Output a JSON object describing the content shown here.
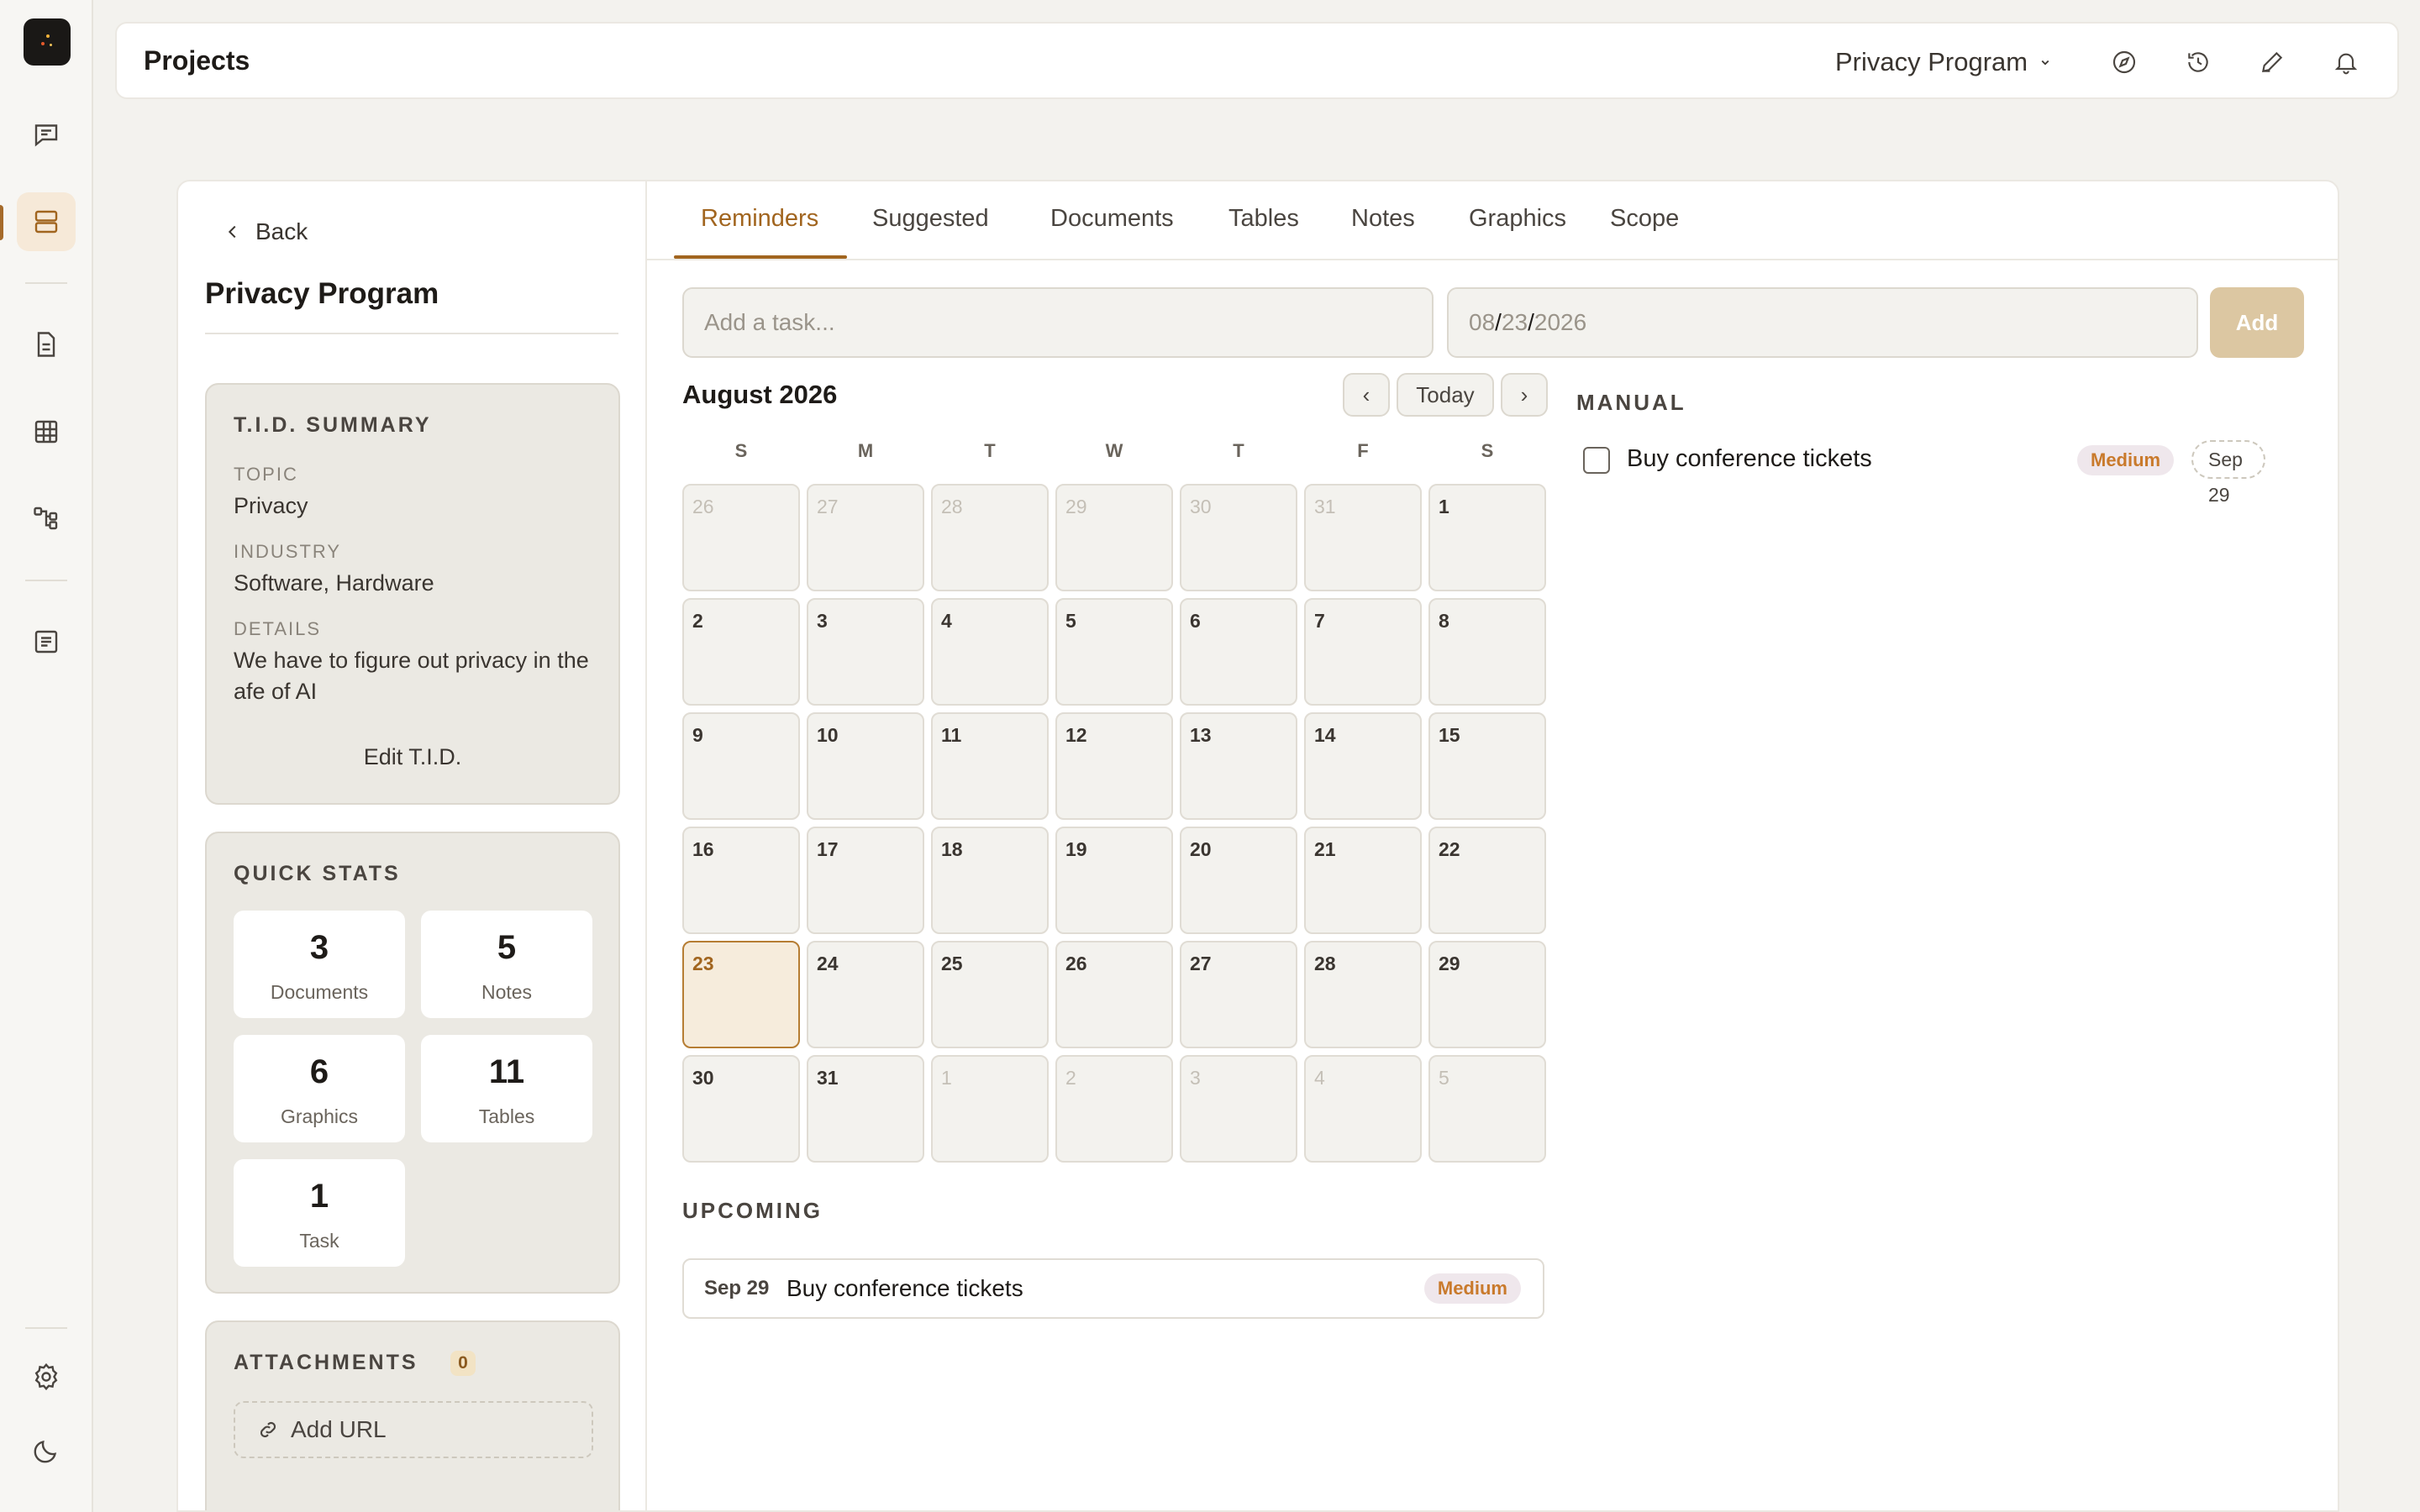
{
  "header": {
    "title": "Projects",
    "project_selector": "Privacy Program"
  },
  "left": {
    "back_label": "Back",
    "project_title": "Privacy Program",
    "tid": {
      "heading": "T.I.D. SUMMARY",
      "topic_label": "TOPIC",
      "topic_value": "Privacy",
      "industry_label": "INDUSTRY",
      "industry_value": "Software, Hardware",
      "details_label": "DETAILS",
      "details_value": "We have to figure out privacy in the afe of AI",
      "edit_label": "Edit T.I.D."
    },
    "stats": {
      "heading": "QUICK STATS",
      "items": [
        {
          "value": "3",
          "label": "Documents"
        },
        {
          "value": "5",
          "label": "Notes"
        },
        {
          "value": "6",
          "label": "Graphics"
        },
        {
          "value": "11",
          "label": "Tables"
        },
        {
          "value": "1",
          "label": "Task"
        }
      ]
    },
    "attachments": {
      "heading": "ATTACHMENTS",
      "count": "0",
      "add_url_label": "Add URL"
    }
  },
  "tabs": [
    "Reminders",
    "Suggested",
    "Documents",
    "Tables",
    "Notes",
    "Graphics",
    "Scope"
  ],
  "task_form": {
    "task_placeholder": "Add a task...",
    "date_month": "08",
    "date_day": "23",
    "date_year": "2026",
    "add_label": "Add"
  },
  "calendar": {
    "month_label": "August 2026",
    "prev_label": "‹",
    "today_label": "Today",
    "next_label": "›",
    "weekdays": [
      "S",
      "M",
      "T",
      "W",
      "T",
      "F",
      "S"
    ],
    "weeks": [
      [
        "26",
        "27",
        "28",
        "29",
        "30",
        "31",
        "1"
      ],
      [
        "2",
        "3",
        "4",
        "5",
        "6",
        "7",
        "8"
      ],
      [
        "9",
        "10",
        "11",
        "12",
        "13",
        "14",
        "15"
      ],
      [
        "16",
        "17",
        "18",
        "19",
        "20",
        "21",
        "22"
      ],
      [
        "23",
        "24",
        "25",
        "26",
        "27",
        "28",
        "29"
      ],
      [
        "30",
        "31",
        "1",
        "2",
        "3",
        "4",
        "5"
      ]
    ]
  },
  "upcoming": {
    "heading": "UPCOMING",
    "items": [
      {
        "date": "Sep 29",
        "title": "Buy conference tickets",
        "priority": "Medium"
      }
    ]
  },
  "manual": {
    "heading": "MANUAL",
    "items": [
      {
        "title": "Buy conference tickets",
        "priority": "Medium",
        "date": "Sep 29",
        "checked": false
      }
    ]
  },
  "colors": {
    "accent": "#a1651f",
    "priority_medium": "#c97a2c",
    "background": "#f3f2ee"
  }
}
